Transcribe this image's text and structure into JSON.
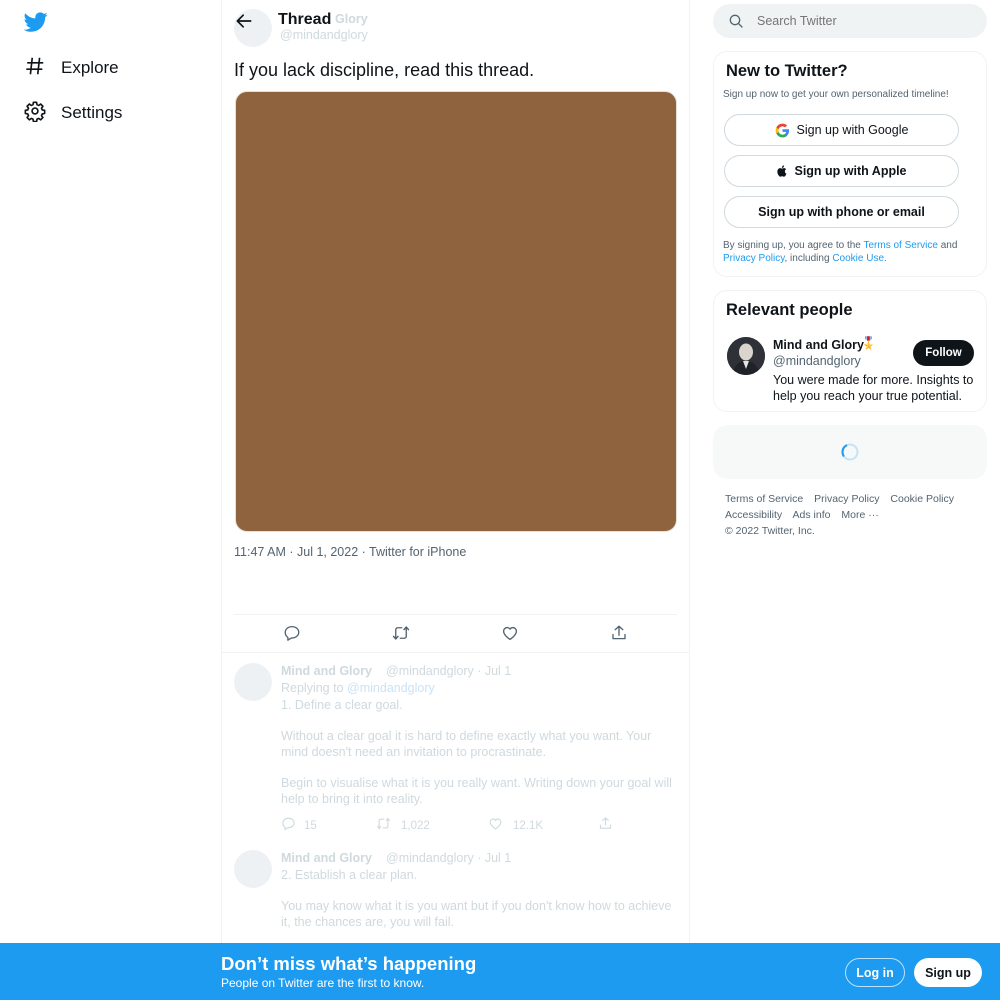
{
  "nav": {
    "logo_icon": "twitter-bird-icon",
    "items": [
      {
        "label": "Explore",
        "icon": "hashtag-icon"
      },
      {
        "label": "Settings",
        "icon": "gear-icon"
      }
    ]
  },
  "header": {
    "title": "Thread",
    "author_name_faded": "Glory",
    "author_handle_faded": "@mindandglory"
  },
  "tweet": {
    "text": "If you lack discipline, read this thread.",
    "media_color": "#8e633d",
    "meta": "11:47 AM · Jul 1, 2022 · Twitter for iPhone",
    "actions": [
      "reply-icon",
      "retweet-icon",
      "like-icon",
      "share-icon"
    ]
  },
  "replies": [
    {
      "name": "Mind and Glory",
      "handle_date": "@mindandglory · Jul 1",
      "replying_prefix": "Replying to",
      "replying_handle": "@mindandglory",
      "paragraphs": [
        "1. Define a clear goal.",
        "Without a clear goal it is hard to define exactly what you want. Your mind doesn't need an invitation to procrastinate.",
        "Begin to visualise what it is you really want. Writing down your goal will help to bring it into reality."
      ],
      "stats": {
        "replies": "15",
        "retweets": "1,022",
        "likes": "12.1K"
      }
    },
    {
      "name": "Mind and Glory",
      "handle_date": "@mindandglory · Jul 1",
      "paragraphs": [
        "2. Establish a clear plan.",
        "You may know what it is you want but if you don't know how to achieve it, the chances are, you will fail."
      ]
    }
  ],
  "search": {
    "placeholder": "Search Twitter"
  },
  "signup_card": {
    "title": "New to Twitter?",
    "subtitle": "Sign up now to get your own personalized timeline!",
    "google": "Sign up with Google",
    "apple": "Sign up with Apple",
    "phone_email": "Sign up with phone or email",
    "legal_1": "By signing up, you agree to the",
    "terms": "Terms of Service",
    "and": "and",
    "privacy": "Privacy Policy",
    "including": ", including",
    "cookie": "Cookie Use."
  },
  "relevant": {
    "title": "Relevant people",
    "name": "Mind and Glory",
    "badge": "🎖️",
    "handle": "@mindandglory",
    "follow": "Follow",
    "bio": "You were made for more. Insights to help you reach your true potential."
  },
  "footer": {
    "links": [
      "Terms of Service",
      "Privacy Policy",
      "Cookie Policy",
      "Accessibility",
      "Ads info",
      "More ···"
    ],
    "copyright": "© 2022 Twitter, Inc."
  },
  "bottom_bar": {
    "title": "Don’t miss what’s happening",
    "subtitle": "People on Twitter are the first to know.",
    "login": "Log in",
    "signup": "Sign up"
  },
  "colors": {
    "accent": "#1d9bf0",
    "text": "#0f1419",
    "muted": "#536471",
    "border": "#eff3f4"
  }
}
